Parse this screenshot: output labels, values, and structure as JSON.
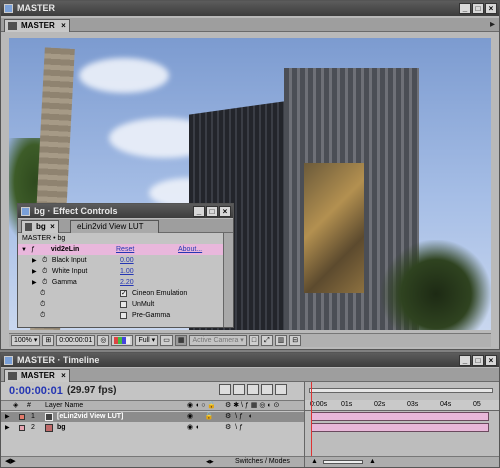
{
  "viewer": {
    "title": "MASTER",
    "tab": "MASTER",
    "zoom": "100%",
    "timecode": "0:00:00:01",
    "resolution": "Full",
    "camera": "Active Camera"
  },
  "effect_controls": {
    "title": "bg · Effect Controls",
    "tab_main": "bg",
    "tab_second": "eLin2vid View LUT",
    "breadcrumb": "MASTER • bg",
    "effect_name": "vid2eLin",
    "reset": "Reset",
    "about": "About...",
    "params": [
      {
        "label": "Black Input",
        "value": "0.00"
      },
      {
        "label": "White Input",
        "value": "1.00"
      },
      {
        "label": "Gamma",
        "value": "2.20"
      }
    ],
    "checkboxes": [
      {
        "label": "Cineon Emulation",
        "checked": true
      },
      {
        "label": "UnMult",
        "checked": false
      },
      {
        "label": "Pre-Gamma",
        "checked": false
      }
    ]
  },
  "timeline": {
    "title": "MASTER · Timeline",
    "tab": "MASTER",
    "timecode": "0:00:00:01",
    "fps": "(29.97 fps)",
    "col_hash": "#",
    "col_layer_name": "Layer Name",
    "layers": [
      {
        "num": "1",
        "name": "[eLin2vid View LUT]",
        "color": "#e27a6a"
      },
      {
        "num": "2",
        "name": "bg",
        "color": "#e8a3b0"
      }
    ],
    "ruler": [
      "0:00s",
      "01s",
      "02s",
      "03s",
      "04s",
      "05"
    ],
    "switches_label": "Switches / Modes"
  },
  "colors": {
    "titlebar": "#4a4a4a",
    "link": "#2536b3",
    "layer_bar": "#e8b7d9",
    "effect_header": "#e9b7dc"
  }
}
